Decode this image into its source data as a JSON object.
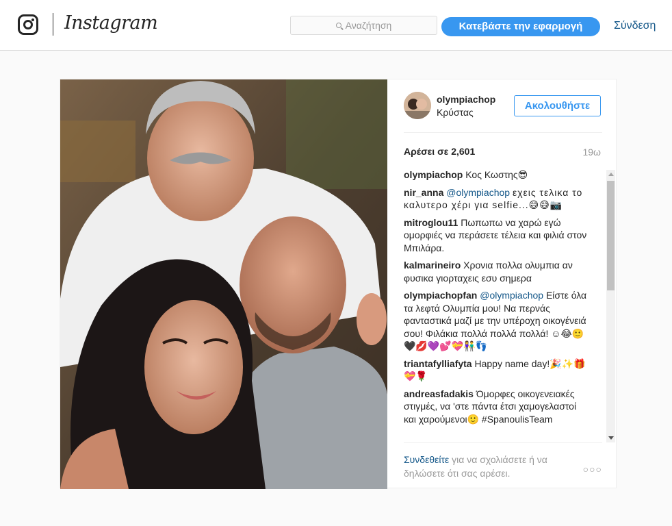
{
  "header": {
    "logo_text": "Instagram",
    "search_placeholder": "Αναζήτηση",
    "download_label": "Κατεβάστε την εφαρμογή",
    "login_label": "Σύνδεση"
  },
  "post": {
    "username": "olympiachop",
    "location": "Κρύστας",
    "follow_label": "Ακολουθήστε",
    "likes": "Αρέσει σε 2,601",
    "time": "19ω",
    "comments": [
      {
        "user": "olympiachop",
        "mention": "",
        "text": "Κος Κωστης😎"
      },
      {
        "user": "nir_anna",
        "mention": "@olympiachop",
        "text": "εχεις τελικα το καλυτερο χέρι για selfie...😅😅📷"
      },
      {
        "user": "mitroglou11",
        "mention": "",
        "text": "Πωπωπω να χαρώ εγώ ομορφιές να περάσετε τέλεια και φιλιά στον Μπιλάρα."
      },
      {
        "user": "kalmarineiro",
        "mention": "",
        "text": "Χρονια πολλα ολυμπια αν φυσικα γιορταχεις εσυ σημερα"
      },
      {
        "user": "olympiachopfan",
        "mention": "@olympiachop",
        "text": "Είστε όλα τα λεφτά Ολυμπία μου! Να περνάς φανταστικά μαζί με την υπέροχη οικογένειά σου! Φιλάκια πολλά πολλά πολλά! ☺😂🙂🖤💋💜💕💝👫👣"
      },
      {
        "user": "triantafylliafyta",
        "mention": "",
        "text": "Happy name day!🎉✨🎁💝🌹"
      },
      {
        "user": "andreasfadakis",
        "mention": "",
        "text": "Όμορφες οικογενειακές στιγμές, να 'στε πάντα έτσι χαμογελαστοί και χαρούμενοι🙂 #SpanoulisTeam"
      }
    ],
    "footer_link": "Συνδεθείτε",
    "footer_text": "για να σχολιάσετε ή να δηλώσετε ότι σας αρέσει.",
    "more_label": "○○○"
  }
}
